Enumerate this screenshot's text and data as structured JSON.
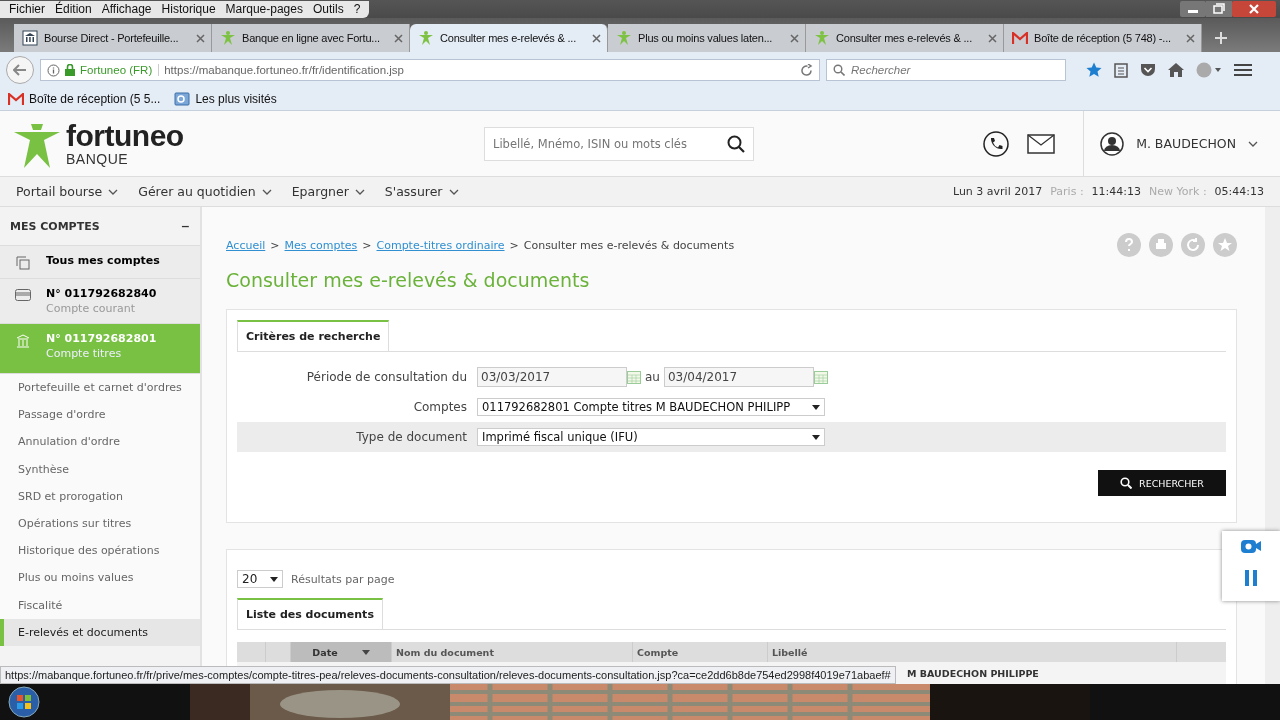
{
  "browser": {
    "menu": [
      "Fichier",
      "Édition",
      "Affichage",
      "Historique",
      "Marque-pages",
      "Outils",
      "?"
    ],
    "tabs": [
      {
        "title": "Bourse Direct - Portefeuille...",
        "kind": "bank",
        "selected": false
      },
      {
        "title": "Banque en ligne avec Fortu...",
        "kind": "green",
        "selected": false
      },
      {
        "title": "Consulter mes e-relevés & ...",
        "kind": "green",
        "selected": true
      },
      {
        "title": "Plus ou moins values laten...",
        "kind": "green",
        "selected": false
      },
      {
        "title": "Consulter mes e-relevés & ...",
        "kind": "green",
        "selected": false
      },
      {
        "title": "Boîte de réception (5 748) -...",
        "kind": "mail",
        "selected": false
      }
    ],
    "identity": "Fortuneo (FR)",
    "url": "https://mabanque.fortuneo.fr/fr/identification.jsp",
    "search_placeholder": "Rechercher",
    "bookmarks": [
      {
        "label": "Boîte de réception (5 5...",
        "kind": "mail"
      },
      {
        "label": "Les plus visités",
        "kind": "folder"
      }
    ],
    "status": "https://mabanque.fortuneo.fr/fr/prive/mes-comptes/compte-titres-pea/releves-documents-consultation/releves-documents-consultation.jsp?ca=ce2dd6b8de754ed2998f4019e71abaef#"
  },
  "site": {
    "logo": "fortuneo",
    "logo_sub": "BANQUE",
    "search_placeholder": "Libellé, Mnémo, ISIN ou mots clés",
    "user": "M. BAUDECHON",
    "nav": [
      "Portail bourse",
      "Gérer au quotidien",
      "Epargner",
      "S'assurer"
    ],
    "date": "Lun 3 avril 2017",
    "clocks": [
      {
        "city": "Paris :",
        "time": "11:44:13"
      },
      {
        "city": "New York :",
        "time": "05:44:13"
      }
    ]
  },
  "sidebar": {
    "title": "MES COMPTES",
    "collapse": "−",
    "accounts": [
      {
        "kind": "all",
        "title": "Tous mes comptes",
        "selected": false
      },
      {
        "kind": "card",
        "title": "N° 011792682840",
        "subtitle": "Compte courant",
        "selected": false
      },
      {
        "kind": "bank",
        "title": "N° 011792682801",
        "subtitle": "Compte titres",
        "selected": true
      }
    ],
    "items": [
      {
        "label": "Portefeuille et carnet d'ordres",
        "selected": false
      },
      {
        "label": "Passage d'ordre",
        "selected": false
      },
      {
        "label": "Annulation d'ordre",
        "selected": false
      },
      {
        "label": "Synthèse",
        "selected": false
      },
      {
        "label": "SRD et prorogation",
        "selected": false
      },
      {
        "label": "Opérations sur titres",
        "selected": false
      },
      {
        "label": "Historique des opérations",
        "selected": false
      },
      {
        "label": "Plus ou moins values",
        "selected": false
      },
      {
        "label": "Fiscalité",
        "selected": false
      },
      {
        "label": "E-relevés et documents",
        "selected": true
      }
    ]
  },
  "main": {
    "breadcrumb": [
      {
        "label": "Accueil",
        "kind": "link"
      },
      {
        "label": "Mes comptes",
        "kind": "link"
      },
      {
        "label": "Compte-titres ordinaire",
        "kind": "link"
      },
      {
        "label": "Consulter mes e-relevés & documents",
        "kind": "current"
      }
    ],
    "separator": ">",
    "title": "Consulter mes e-relevés & documents",
    "criteria": {
      "tab": "Critères de recherche",
      "period_label": "Période de consultation du",
      "from": "03/03/2017",
      "to_label": "au",
      "to": "03/04/2017",
      "account_label": "Comptes",
      "account": "011792682801 Compte titres M BAUDECHON PHILIPP",
      "type_label": "Type de document",
      "type": "Imprimé fiscal unique (IFU)",
      "button": "RECHERCHER"
    },
    "results": {
      "per_page": "20",
      "per_page_label": "Résultats par page",
      "tab": "Liste des documents",
      "columns": [
        {
          "label": "Date",
          "sorted": true
        },
        {
          "label": "Nom du document",
          "sorted": false
        },
        {
          "label": "Compte",
          "sorted": false
        },
        {
          "label": "Libellé",
          "sorted": false
        }
      ],
      "row_libelle": "M BAUDECHON PHILIPPE"
    }
  }
}
